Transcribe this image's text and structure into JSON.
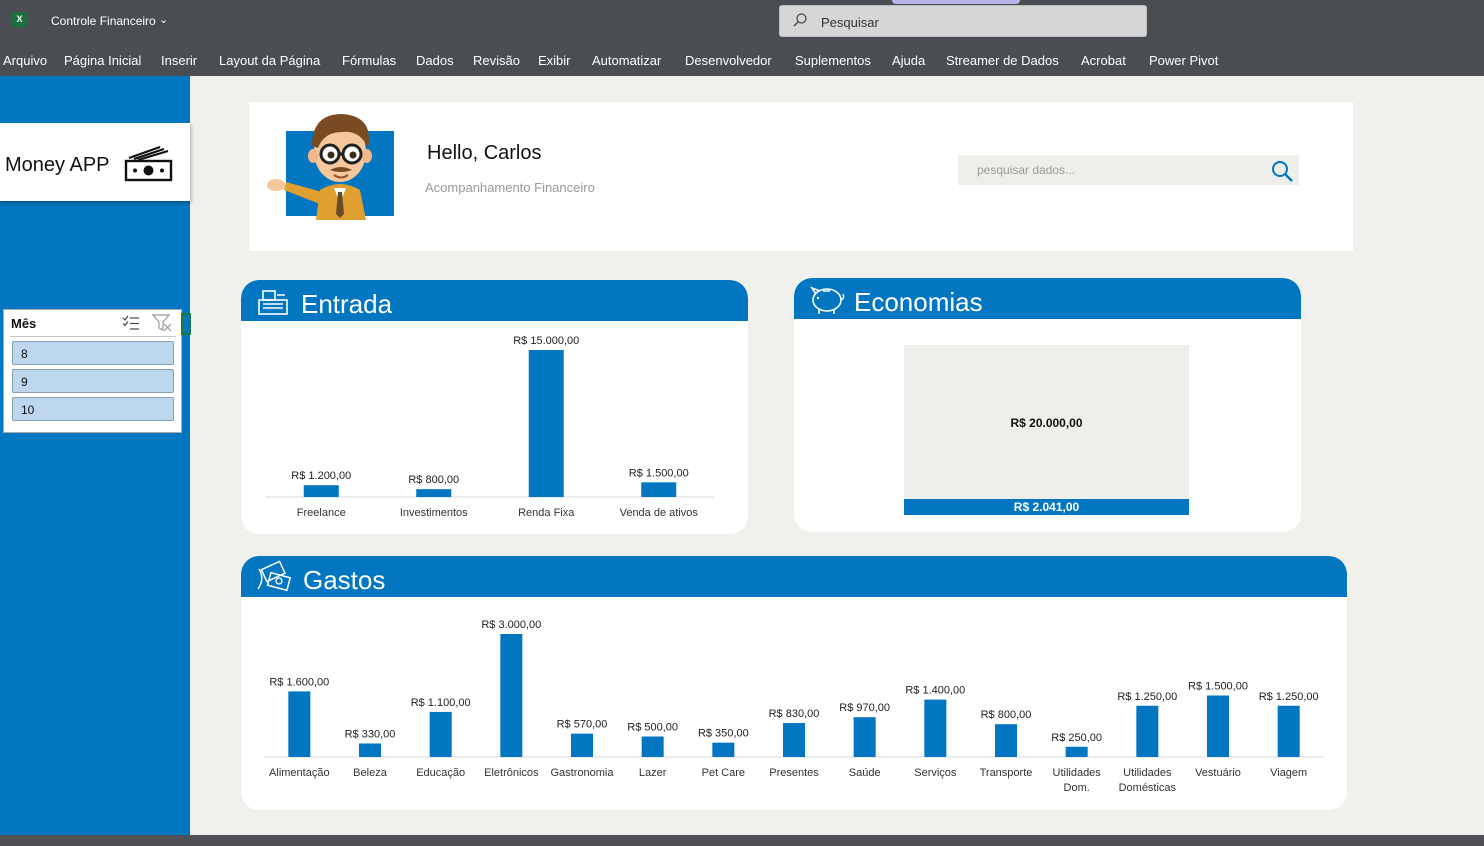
{
  "window": {
    "doc_title": "Controle Financeiro",
    "search_placeholder": "Pesquisar"
  },
  "ribbon": {
    "tabs": [
      "Arquivo",
      "Página Inicial",
      "Inserir",
      "Layout da Página",
      "Fórmulas",
      "Dados",
      "Revisão",
      "Exibir",
      "Automatizar",
      "Desenvolvedor",
      "Suplementos",
      "Ajuda",
      "Streamer de Dados",
      "Acrobat",
      "Power Pivot"
    ]
  },
  "sidebar": {
    "app_name": "Money APP",
    "slicer": {
      "title": "Mês",
      "items": [
        "8",
        "9",
        "10"
      ]
    }
  },
  "header": {
    "greeting": "Hello, Carlos",
    "subtitle": "Acompanhamento Financeiro",
    "search_placeholder": "pesquisar dados..."
  },
  "panels": {
    "entrada": "Entrada",
    "economias": "Economias",
    "gastos": "Gastos"
  },
  "colors": {
    "accent": "#0276c0",
    "panel_bg": "#ffffff",
    "page_bg": "#f0f0ec"
  },
  "chart_data": [
    {
      "type": "bar",
      "categories": [
        "Freelance",
        "Investimentos",
        "Renda Fixa",
        "Venda de ativos"
      ],
      "values": [
        1200,
        800,
        15000,
        1500
      ],
      "labels": [
        "R$ 1.200,00",
        "R$ 800,00",
        "R$ 15.000,00",
        "R$ 1.500,00"
      ],
      "ylim": [
        0,
        15000
      ]
    },
    {
      "type": "bar",
      "goal_label": "R$ 20.000,00",
      "current_label": "R$ 2.041,00",
      "goal": 20000,
      "current": 2041
    },
    {
      "type": "bar",
      "categories": [
        "Alimentação",
        "Beleza",
        "Educação",
        "Eletrônicos",
        "Gastronomia",
        "Lazer",
        "Pet Care",
        "Presentes",
        "Saúde",
        "Serviços",
        "Transporte",
        "Utilidades Dom.",
        "Utilidades Domésticas",
        "Vestuário",
        "Viagem"
      ],
      "values": [
        1600,
        330,
        1100,
        3000,
        570,
        500,
        350,
        830,
        970,
        1400,
        800,
        250,
        1250,
        1500,
        1250
      ],
      "labels": [
        "R$ 1.600,00",
        "R$ 330,00",
        "R$ 1.100,00",
        "R$ 3.000,00",
        "R$ 570,00",
        "R$ 500,00",
        "R$ 350,00",
        "R$ 830,00",
        "R$ 970,00",
        "R$ 1.400,00",
        "R$ 800,00",
        "R$ 250,00",
        "R$ 1.250,00",
        "R$ 1.500,00",
        "R$ 1.250,00"
      ],
      "ylim": [
        0,
        3000
      ]
    }
  ]
}
